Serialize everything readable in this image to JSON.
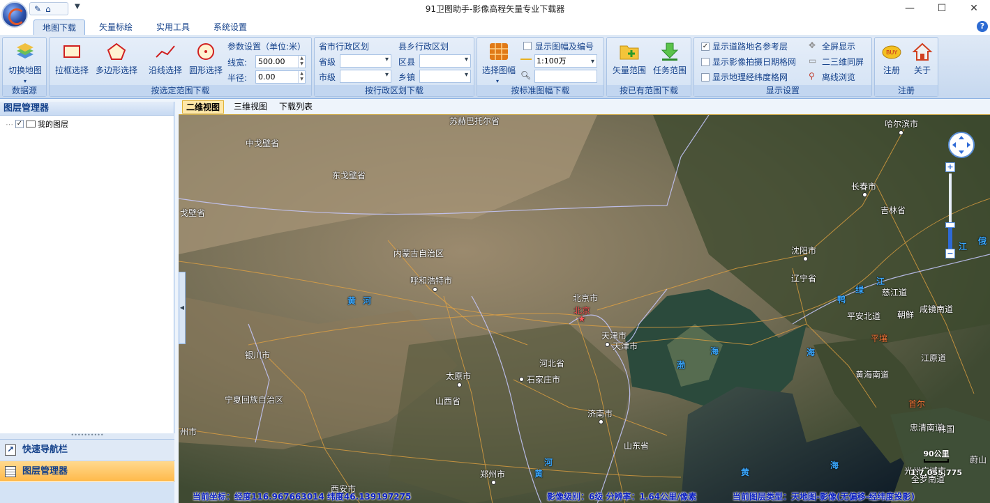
{
  "window": {
    "title": "91卫图助手-影像高程矢量专业下载器",
    "minimize": "—",
    "maximize": "☐",
    "close": "✕"
  },
  "menu_tabs": [
    {
      "label": "地图下载"
    },
    {
      "label": "矢量标绘"
    },
    {
      "label": "实用工具"
    },
    {
      "label": "系统设置"
    }
  ],
  "ribbon": {
    "data_source": {
      "button": "切换地图",
      "group": "数据源"
    },
    "range_select": {
      "rect": "拉框选择",
      "polygon": "多边形选择",
      "line": "沿线选择",
      "circle": "圆形选择",
      "params_title": "参数设置（单位:米）",
      "line_width_label": "线宽:",
      "line_width_value": "500.00",
      "radius_label": "半径:",
      "radius_value": "0.00",
      "group": "按选定范围下载"
    },
    "admin": {
      "prov_city_title": "省市行政区划",
      "province_label": "省级",
      "city_label": "市级",
      "county_title": "县乡行政区划",
      "district_label": "区县",
      "town_label": "乡镇",
      "group": "按行政区划下载"
    },
    "sheet": {
      "button": "选择图幅",
      "show_sheet": "显示图幅及编号",
      "scale_value": "1:100万",
      "group": "按标准图幅下载"
    },
    "existing": {
      "vector": "矢量范围",
      "task": "任务范围",
      "group": "按已有范围下载"
    },
    "display": {
      "road_layer": "显示道路地名参考层",
      "capture_date": "显示影像拍摄日期格网",
      "latlon_grid": "显示地理经纬度格网",
      "fullscreen": "全屏显示",
      "dual_screen": "二三维同屏",
      "offline": "离线浏览",
      "group": "显示设置"
    },
    "register": {
      "register": "注册",
      "about": "关于",
      "group": "注册"
    }
  },
  "left": {
    "header": "图层管理器",
    "tree_item": "我的图层",
    "nav_quick": "快速导航栏",
    "nav_layers": "图层管理器"
  },
  "view_tabs": [
    {
      "label": "二维视图"
    },
    {
      "label": "三维视图"
    },
    {
      "label": "下载列表"
    }
  ],
  "map": {
    "labels": [
      {
        "text": "苏赫巴托尔省"
      },
      {
        "text": "中戈壁省"
      },
      {
        "text": "东戈壁省"
      },
      {
        "text": "戈壁省"
      },
      {
        "text": "内蒙古自治区"
      },
      {
        "text": "呼和浩特市"
      },
      {
        "text": "黄"
      },
      {
        "text": "河"
      },
      {
        "text": "北京市"
      },
      {
        "text": "北京"
      },
      {
        "text": "天津市"
      },
      {
        "text": "天津市"
      },
      {
        "text": "银川市"
      },
      {
        "text": "太原市"
      },
      {
        "text": "河北省"
      },
      {
        "text": "石家庄市"
      },
      {
        "text": "宁夏回族自治区"
      },
      {
        "text": "山西省"
      },
      {
        "text": "济南市"
      },
      {
        "text": "山东省"
      },
      {
        "text": "郑州市"
      },
      {
        "text": "西安市"
      },
      {
        "text": "州市"
      },
      {
        "text": "河"
      },
      {
        "text": "黄"
      },
      {
        "text": "哈尔滨市"
      },
      {
        "text": "长春市"
      },
      {
        "text": "吉林省"
      },
      {
        "text": "沈阳市"
      },
      {
        "text": "辽宁省"
      },
      {
        "text": "绿"
      },
      {
        "text": "江"
      },
      {
        "text": "鸭"
      },
      {
        "text": "慈江道"
      },
      {
        "text": "平安北道"
      },
      {
        "text": "朝鲜"
      },
      {
        "text": "咸镜南道"
      },
      {
        "text": "平壤"
      },
      {
        "text": "江原道"
      },
      {
        "text": "黄海南道"
      },
      {
        "text": "首尔"
      },
      {
        "text": "忠清南道"
      },
      {
        "text": "韩国"
      },
      {
        "text": "光州广域市"
      },
      {
        "text": "全罗南道"
      },
      {
        "text": "蔚山"
      },
      {
        "text": "海"
      },
      {
        "text": "渤"
      },
      {
        "text": "海"
      },
      {
        "text": "黄"
      },
      {
        "text": "海"
      },
      {
        "text": "江"
      },
      {
        "text": "俄"
      }
    ],
    "scale": {
      "distance": "90公里",
      "ratio": "1:7,055,775"
    },
    "status": {
      "coords": "当前坐标：经度116.967663014 纬度46.139197275",
      "level": "影像级别：6级 分辨率：1.64公里/像素",
      "layer_type": "当前图层类型：天地图-影像(无偏移-经纬度投影)"
    }
  },
  "colors": {
    "accent": "#15428b",
    "ribbon": "#dfe9f6",
    "active_nav": "#ffb94a"
  }
}
